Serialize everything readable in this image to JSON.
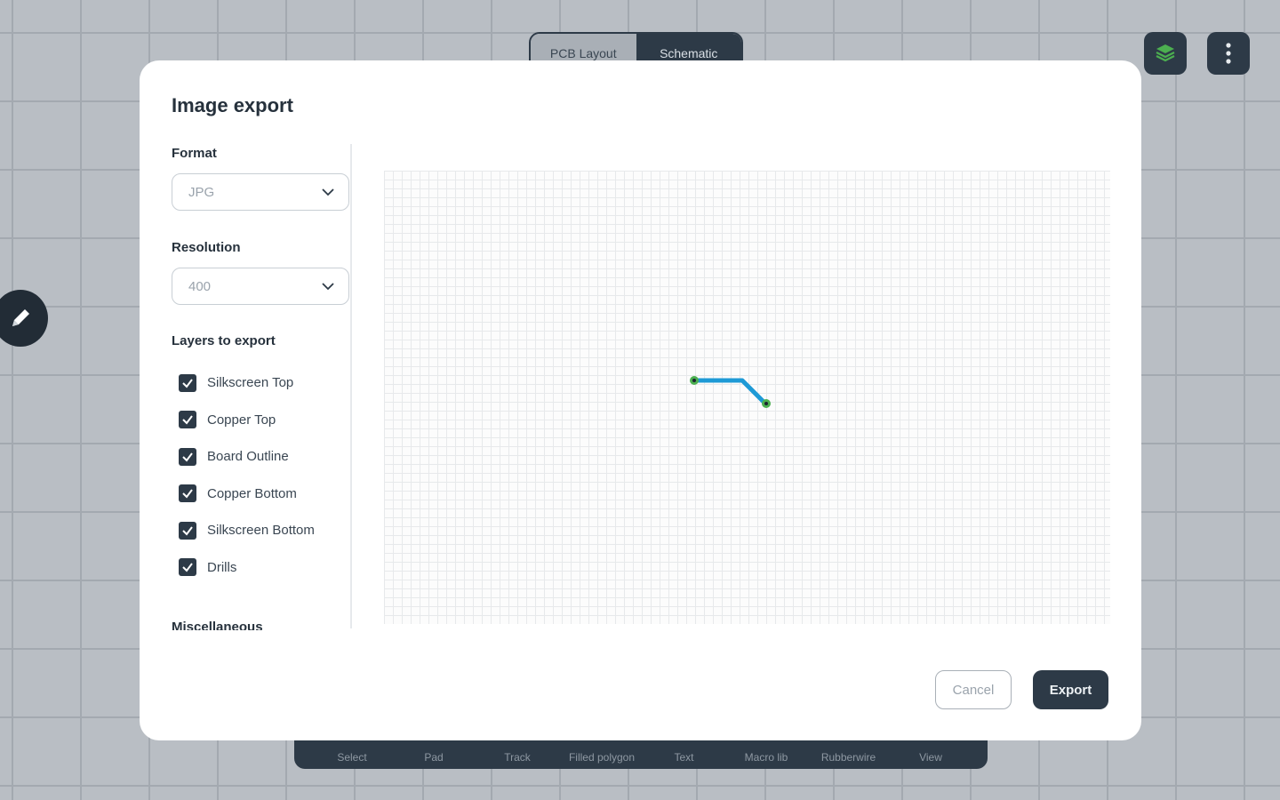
{
  "view_tabs": [
    {
      "label": "PCB Layout",
      "active": false
    },
    {
      "label": "Schematic",
      "active": true
    }
  ],
  "top_buttons": {
    "layers_icon": "layers-icon",
    "menu_icon": "more-vertical-icon"
  },
  "edit_fab_icon": "pencil-icon",
  "toolbar": {
    "items": [
      "Select",
      "Pad",
      "Track",
      "Filled polygon",
      "Text",
      "Macro lib",
      "Rubberwire",
      "View"
    ]
  },
  "modal": {
    "title": "Image export",
    "format": {
      "label": "Format",
      "value": "JPG"
    },
    "resolution": {
      "label": "Resolution",
      "value": "400"
    },
    "layers_label": "Layers to export",
    "layers": [
      {
        "label": "Silkscreen Top",
        "checked": true
      },
      {
        "label": "Copper Top",
        "checked": true
      },
      {
        "label": "Board Outline",
        "checked": true
      },
      {
        "label": "Copper Bottom",
        "checked": true
      },
      {
        "label": "Silkscreen Bottom",
        "checked": true
      },
      {
        "label": "Drills",
        "checked": true
      }
    ],
    "misc_label": "Miscellaneous",
    "cancel_label": "Cancel",
    "export_label": "Export"
  },
  "colors": {
    "dark": "#2d3a47",
    "trace": "#1e9ad6",
    "pad": "#4caf50"
  }
}
